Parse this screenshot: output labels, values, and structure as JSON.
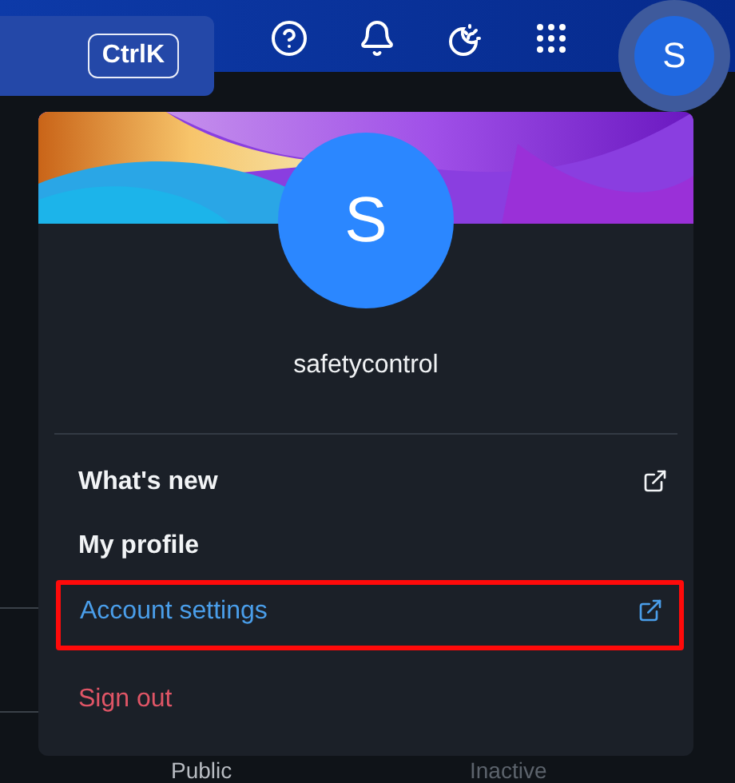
{
  "header": {
    "search": {
      "shortcut": "CtrlK"
    },
    "icons": [
      {
        "kind": "help"
      },
      {
        "kind": "bell"
      },
      {
        "kind": "theme"
      },
      {
        "kind": "apps"
      }
    ],
    "avatar": {
      "initial": "S",
      "selected": true
    }
  },
  "background_rows": [
    {
      "column_1": "Public",
      "column_2": "Inactive"
    }
  ],
  "account_menu": {
    "initial": "S",
    "username": "safetycontrol",
    "items": [
      {
        "label": "What's new",
        "kind": "normal",
        "external": true,
        "highlighted": false
      },
      {
        "label": "My profile",
        "kind": "normal",
        "external": false,
        "highlighted": false
      },
      {
        "label": "Account settings",
        "kind": "link",
        "external": true,
        "highlighted": true
      },
      {
        "label": "Sign out",
        "kind": "danger",
        "external": false,
        "highlighted": false
      }
    ]
  }
}
